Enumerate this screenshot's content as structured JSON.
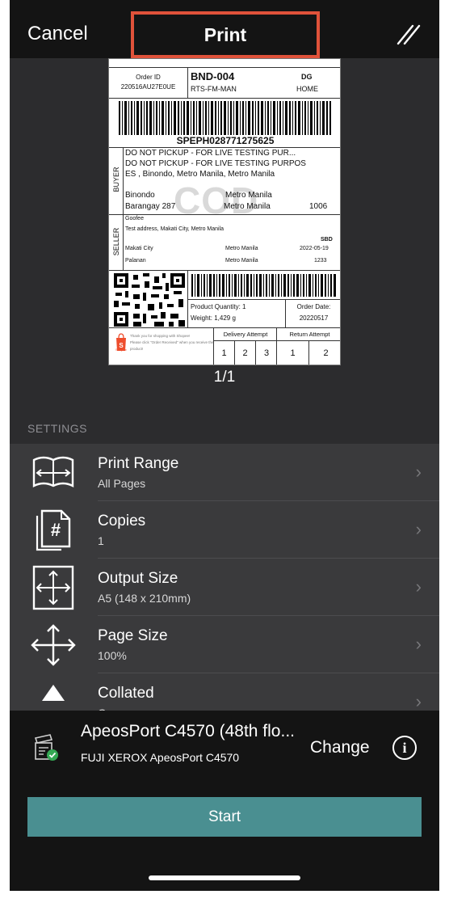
{
  "nav": {
    "cancel": "Cancel",
    "title": "Print"
  },
  "label": {
    "order_id_label": "Order ID",
    "order_id": "220516AU27E0UE",
    "sort_code": "BND-004",
    "route": "RTS-FM-MAN",
    "type_code": "DG",
    "type_label": "HOME",
    "tracking_number": "SPEPH028771275625",
    "buyer_label": "BUYER",
    "buyer_line1": "DO NOT PICKUP - FOR LIVE TESTING PUR...",
    "buyer_line2": "DO NOT PICKUP - FOR LIVE TESTING PURPOS",
    "buyer_line3": "ES , Binondo, Metro Manila, Metro Manila",
    "buyer_district": "Binondo",
    "buyer_barangay": "Barangay 287",
    "buyer_region1": "Metro Manila",
    "buyer_region2": "Metro Manila",
    "buyer_zip": "1006",
    "cod": "COD",
    "seller_label": "SELLER",
    "seller_name": "Goofee",
    "seller_address": "Test address, Makati City, Metro Manila",
    "seller_service": "SBD",
    "seller_city": "Makati City",
    "seller_region1": "Metro Manila",
    "seller_date": "2022-05-19",
    "seller_district": "Palanan",
    "seller_region2": "Metro Manila",
    "seller_zip": "1233",
    "product_qty_label": "Product Quantity:",
    "product_qty": "1",
    "weight_label": "Weight:",
    "weight": "1,429 g",
    "order_date_label": "Order Date:",
    "order_date": "20220517",
    "shopee_note1": "Thank you for shopping with Shopee!",
    "shopee_note2": "Please click \"Order Received\" when you receive the",
    "shopee_note3": "product!",
    "shopee_logo_text": "Shopee",
    "delivery_attempt_label": "Delivery Attempt",
    "delivery_attempts": [
      "1",
      "2",
      "3"
    ],
    "return_attempt_label": "Return Attempt",
    "return_attempts": [
      "1",
      "2"
    ]
  },
  "page_count": "1/1",
  "settings": {
    "heading": "SETTINGS",
    "items": [
      {
        "title": "Print Range",
        "subtitle": "All Pages",
        "icon": "print-range-icon"
      },
      {
        "title": "Copies",
        "subtitle": "1",
        "icon": "copies-icon"
      },
      {
        "title": "Output Size",
        "subtitle": "A5 (148 x 210mm)",
        "icon": "output-size-icon"
      },
      {
        "title": "Page Size",
        "subtitle": "100%",
        "icon": "page-size-icon"
      },
      {
        "title": "Collated",
        "subtitle": "On",
        "icon": "collated-icon"
      }
    ]
  },
  "printer": {
    "name": "ApeosPort C4570 (48th flo...",
    "model": "FUJI XEROX ApeosPort C4570",
    "change": "Change"
  },
  "start": "Start",
  "colors": {
    "accent": "#4a8f91",
    "highlight": "#e0523a"
  }
}
